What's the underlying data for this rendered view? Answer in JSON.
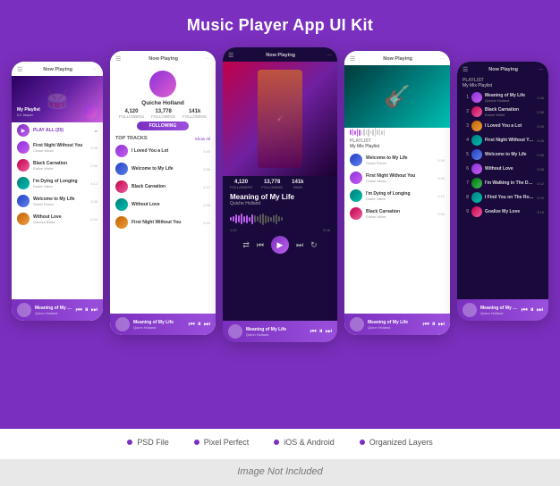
{
  "page": {
    "title": "Music Player App UI Kit",
    "background_color": "#7B2FBE"
  },
  "phones": [
    {
      "id": "phone1",
      "theme": "light",
      "size": "small",
      "topbar": "Now Playing",
      "playlist_label": "My Playlist",
      "playlist_sub": "DJ Jasper",
      "songs": [
        {
          "name": "Play All (25)",
          "artist": "",
          "dur": "",
          "type": "play_all"
        },
        {
          "name": "First Night Without You",
          "artist": "Chase Music",
          "dur": "3:45",
          "color": "purple"
        },
        {
          "name": "Black Carnation",
          "artist": "Elaine White",
          "dur": "2:56",
          "color": "pink"
        },
        {
          "name": "I'm Dying of Longing",
          "artist": "Drake Yates",
          "dur": "4:12",
          "color": "teal"
        },
        {
          "name": "Welcome to My Life",
          "artist": "Guido Flores",
          "dur": "3:38",
          "color": "blue"
        },
        {
          "name": "Without Love",
          "artist": "Odessa Blake",
          "dur": "5:20",
          "color": "orange"
        }
      ],
      "now_playing": {
        "title": "Meaning of My Life",
        "artist": "Quinn Holland"
      }
    },
    {
      "id": "phone2",
      "theme": "light",
      "size": "tall",
      "topbar": "Now Playing",
      "profile": {
        "name": "Quiche Holland",
        "followers": "4,120",
        "following": "13,778",
        "fans": "141k",
        "follow_btn": "FOLLOWING"
      },
      "section_title": "TOP TRACKS",
      "section_link": "Show All",
      "songs": [
        {
          "name": "I Loved You a Lot",
          "artist": "",
          "dur": "3:45",
          "color": "purple"
        },
        {
          "name": "Welcome to My Life",
          "artist": "",
          "dur": "2:56",
          "color": "blue"
        },
        {
          "name": "Black Carnation",
          "artist": "",
          "dur": "4:12",
          "color": "pink"
        },
        {
          "name": "Without Love",
          "artist": "",
          "dur": "3:38",
          "color": "teal"
        },
        {
          "name": "First Night Without You",
          "artist": "",
          "dur": "5:20",
          "color": "orange"
        }
      ],
      "now_playing": {
        "title": "Meaning of My Life",
        "artist": "Quinn Holland"
      }
    },
    {
      "id": "phone3",
      "theme": "dark",
      "size": "featured",
      "stats": {
        "followers": "4,120",
        "following": "13,778",
        "fans": "141k"
      },
      "song_title": "Meaning of My Life",
      "song_artist": "Quiche Holland",
      "time_current": "1:22",
      "time_total": "5:16",
      "now_playing": {
        "title": "Meaning of My Life",
        "artist": "Quinn Holland"
      }
    },
    {
      "id": "phone4",
      "theme": "light",
      "size": "tall",
      "topbar": "Now Playing",
      "playlist_label": "PLAYLIST",
      "playlist_sub": "My Mix Playlist",
      "songs": [
        {
          "name": "Welcome to My Life",
          "artist": "Guido Flores",
          "dur": "3:38",
          "color": "blue"
        },
        {
          "name": "First Night Without You",
          "artist": "Chase Music",
          "dur": "3:45",
          "color": "purple"
        },
        {
          "name": "I'm Dying of Longing",
          "artist": "Drake Yates",
          "dur": "4:12",
          "color": "teal"
        },
        {
          "name": "Black Carnation",
          "artist": "Elaine White",
          "dur": "2:56",
          "color": "pink"
        }
      ],
      "now_playing": {
        "title": "Meaning of My Life",
        "artist": "Quinn Holland"
      }
    },
    {
      "id": "phone5",
      "theme": "dark",
      "size": "small",
      "topbar": "Now Playing",
      "playlist_label": "PLAYLIST",
      "playlist_sub": "My Mix Playlist",
      "songs": [
        {
          "name": "Meaning of My Life",
          "artist": "Quiche Holland",
          "dur": "2:46",
          "color": "purple",
          "num": 1
        },
        {
          "name": "Black Carnation",
          "artist": "Elaine White",
          "dur": "2:56",
          "color": "pink",
          "num": 2
        },
        {
          "name": "I Loved You a Lot",
          "artist": "",
          "dur": "3:45",
          "color": "orange",
          "num": 3
        },
        {
          "name": "First Night Without You",
          "artist": "",
          "dur": "3:45",
          "color": "teal",
          "num": 4
        },
        {
          "name": "Welcome to My Life",
          "artist": "",
          "dur": "2:56",
          "color": "blue",
          "num": 5
        },
        {
          "name": "Without Love",
          "artist": "",
          "dur": "3:38",
          "color": "purple",
          "num": 6
        },
        {
          "name": "I'm Walking in The Dark",
          "artist": "",
          "dur": "4:12",
          "color": "green",
          "num": 7
        },
        {
          "name": "I Find You on The Roads",
          "artist": "",
          "dur": "5:20",
          "color": "teal",
          "num": 8
        },
        {
          "name": "Goalize My Love",
          "artist": "",
          "dur": "3:15",
          "color": "pink",
          "num": 9
        }
      ],
      "now_playing": {
        "title": "Meaning of My Life",
        "artist": "Quinn Holland"
      }
    }
  ],
  "footer": {
    "features": [
      "PSD File",
      "Pixel Perfect",
      "iOS & Android",
      "Organized Layers"
    ],
    "bottom_note": "Image Not Included"
  }
}
